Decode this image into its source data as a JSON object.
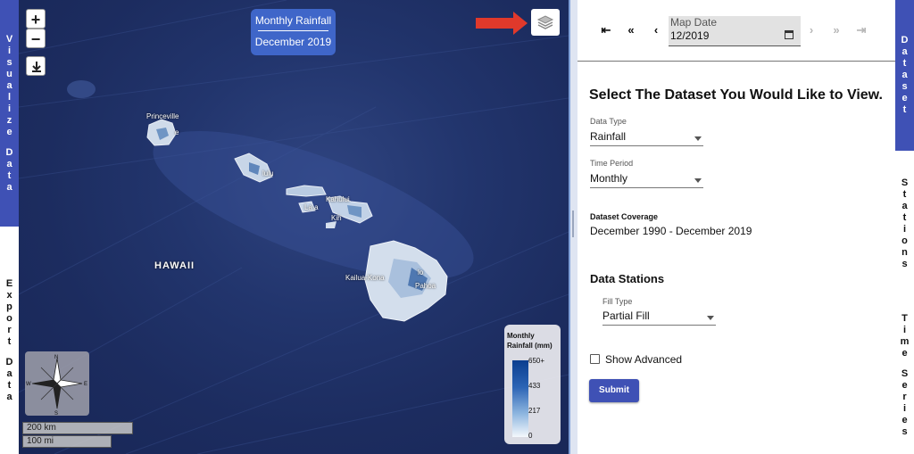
{
  "left_tabs": {
    "visualize": [
      "V",
      "i",
      "s",
      "u",
      "a",
      "l",
      "i",
      "z",
      "e",
      "",
      "D",
      "a",
      "t",
      "a"
    ],
    "export": [
      "E",
      "x",
      "p",
      "o",
      "r",
      "t",
      "",
      "D",
      "a",
      "t",
      "a"
    ]
  },
  "map": {
    "zoom_in": "+",
    "zoom_out": "−",
    "download_icon": "download-icon",
    "title_line1": "Monthly Rainfall",
    "title_line2": "December 2019",
    "layers_icon": "layers-icon",
    "arrow_color": "#e0392b",
    "labels": {
      "princeville": "Princeville",
      "e": "e",
      "lulu": "lulu",
      "lahaina": "La  a",
      "kahului": "Kahului",
      "kihei": "Kih",
      "kailua_kona": "Kailua-Kona",
      "hilo": "lo",
      "pahoa": "Pahoa",
      "hawaii": "HAWAII"
    },
    "compass": {
      "n": "N",
      "s": "S",
      "e": "E",
      "w": "W"
    },
    "scale_km": "200 km",
    "scale_mi": "100 mi",
    "legend": {
      "title_line1": "Monthly",
      "title_line2": "Rainfall (mm)",
      "ticks": [
        "650+",
        "433",
        "217",
        "0"
      ],
      "color_high": "#0b3e8f",
      "color_low": "#f4f8fc"
    }
  },
  "navbar": {
    "first": "⇤",
    "prev_far": "«",
    "prev": "‹",
    "date_label": "Map Date",
    "date_value": "12/2019",
    "next": "›",
    "next_far": "»",
    "last": "⇥"
  },
  "form": {
    "heading": "Select The Dataset You Would Like to View.",
    "data_type_label": "Data Type",
    "data_type_value": "Rainfall",
    "time_period_label": "Time Period",
    "time_period_value": "Monthly",
    "coverage_label": "Dataset Coverage",
    "coverage_value": "December 1990 - December 2019",
    "stations_heading": "Data Stations",
    "fill_type_label": "Fill Type",
    "fill_type_value": "Partial Fill",
    "show_advanced": "Show Advanced",
    "submit": "Submit"
  },
  "right_tabs": {
    "dataset": [
      "D",
      "a",
      "t",
      "a",
      "s",
      "e",
      "t"
    ],
    "stations": [
      "S",
      "t",
      "a",
      "t",
      "i",
      "o",
      "n",
      "s"
    ],
    "timeseries": [
      "T",
      "i",
      "m",
      "e",
      "",
      "S",
      "e",
      "r",
      "i",
      "e",
      "s"
    ]
  },
  "colors": {
    "accent": "#3f51b5",
    "title_box": "#3f66c9",
    "ocean": "#22356d"
  }
}
